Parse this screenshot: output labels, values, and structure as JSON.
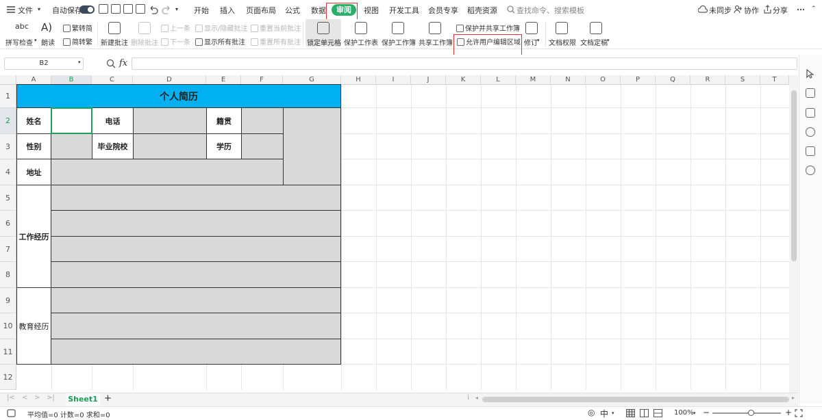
{
  "menubar": {
    "file": "文件",
    "autosave": "自动保存",
    "tabs": [
      "开始",
      "插入",
      "页面布局",
      "公式",
      "数据",
      "审阅",
      "视图",
      "开发工具",
      "会员专享",
      "稻壳资源"
    ],
    "search_placeholder": "查找命令、搜索模板",
    "sync": "未同步",
    "collab": "协作",
    "share": "分享"
  },
  "ribbon": {
    "spellcheck": "拼写检查",
    "read": "朗读",
    "trad_to_simp": "繁转简",
    "simp_to_trad": "简转繁",
    "new_comment": "新建批注",
    "delete_comment": "删除批注",
    "prev": "上一条",
    "next": "下一条",
    "show_hide_comment": "显示/隐藏批注",
    "show_all_comments": "显示所有批注",
    "reset_current_comment": "重置当前批注",
    "reset_all_comments": "重置所有批注",
    "lock_cell": "锁定单元格",
    "protect_sheet": "保护工作表",
    "protect_workbook": "保护工作簿",
    "share_workbook": "共享工作簿",
    "protect_share_workbook": "保护并共享工作簿",
    "allow_edit_ranges": "允许用户编辑区域",
    "revise": "修订",
    "doc_permission": "文档权限",
    "doc_finalize": "文档定稿"
  },
  "formula": {
    "namebox": "B2",
    "fx": "fx"
  },
  "columns": [
    "A",
    "B",
    "C",
    "D",
    "E",
    "F",
    "G",
    "H",
    "I",
    "J",
    "K",
    "L",
    "M",
    "N",
    "O",
    "P",
    "Q",
    "R",
    "S",
    "T"
  ],
  "rows": [
    "1",
    "2",
    "3",
    "4",
    "5",
    "6",
    "7",
    "8",
    "9",
    "10",
    "11",
    "12"
  ],
  "resume": {
    "title": "个人简历",
    "name": "姓名",
    "phone": "电话",
    "origin": "籍贯",
    "gender": "性别",
    "school": "毕业院校",
    "education": "学历",
    "address": "地址",
    "work": "工作经历",
    "edu_history": "教育经历"
  },
  "sheet": {
    "tab": "Sheet1",
    "add": "+"
  },
  "status": {
    "summary": "平均值=0 计数=0 求和=0",
    "zoom": "100%"
  },
  "colors": {
    "accent": "#2aae68",
    "title_fill": "#00b0f0",
    "gray_fill": "#d9d9d9",
    "highlight": "#e03030"
  }
}
